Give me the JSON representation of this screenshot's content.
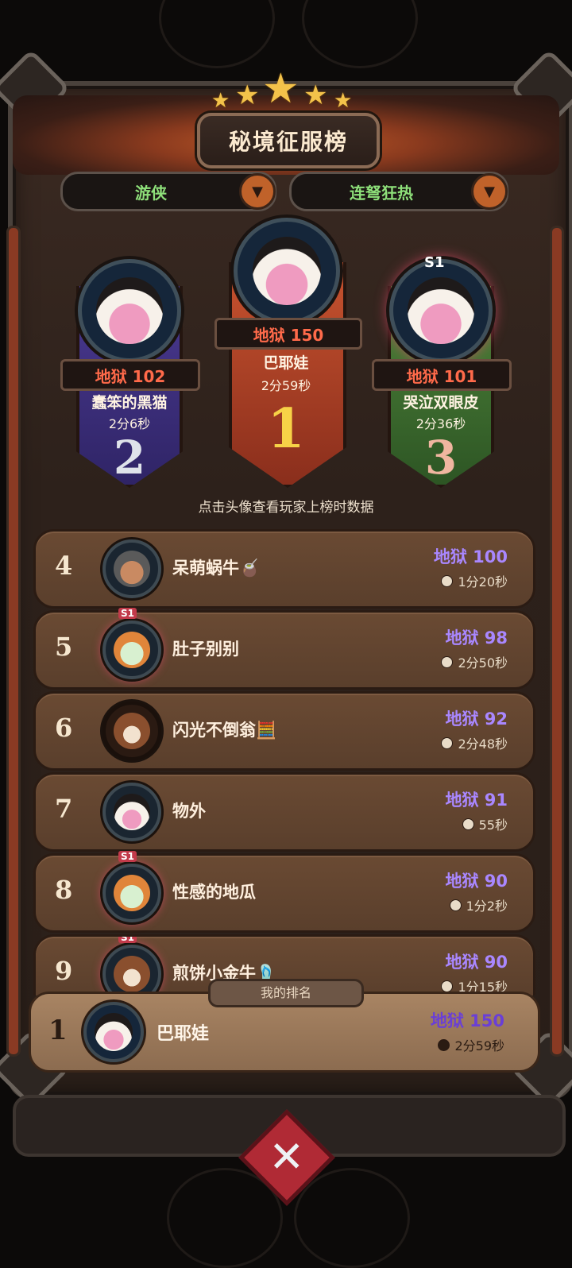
{
  "title": "秘境征服榜",
  "filters": {
    "class_label": "游侠",
    "skill_label": "连弩狂热"
  },
  "podium": [
    {
      "rank": "1",
      "hell": "地狱 150",
      "name": "巴耶娃",
      "time": "2分59秒",
      "color": "#b5432b"
    },
    {
      "rank": "2",
      "hell": "地狱 102",
      "name": "蠢笨的黑猫",
      "time": "2分6秒",
      "color": "#3d2f7a"
    },
    {
      "rank": "3",
      "hell": "地狱 101",
      "name": "哭泣双眼皮",
      "time": "2分36秒",
      "color": "#3f6a2f",
      "badge": "S1"
    }
  ],
  "hint": "点击头像查看玩家上榜时数据",
  "list": [
    {
      "rank": "4",
      "name": "呆萌蜗牛🧉",
      "score": "地狱 100",
      "time": "1分20秒"
    },
    {
      "rank": "5",
      "name": "肚子别别",
      "score": "地狱 98",
      "time": "2分50秒",
      "badge": "S1"
    },
    {
      "rank": "6",
      "name": "闪光不倒翁🧮",
      "score": "地狱 92",
      "time": "2分48秒"
    },
    {
      "rank": "7",
      "name": "物外",
      "score": "地狱 91",
      "time": "55秒"
    },
    {
      "rank": "8",
      "name": "性感的地瓜",
      "score": "地狱 90",
      "time": "1分2秒",
      "badge": "S1"
    },
    {
      "rank": "9",
      "name": "煎饼小金牛🩴",
      "score": "地狱 90",
      "time": "1分15秒",
      "badge": "S1"
    }
  ],
  "my_rank": {
    "label": "我的排名",
    "rank": "1",
    "name": "巴耶娃",
    "score": "地狱 150",
    "time": "2分59秒"
  },
  "icons": {
    "dropdown": "chevron-down-icon",
    "close": "close-icon",
    "clock": "clock-icon"
  }
}
